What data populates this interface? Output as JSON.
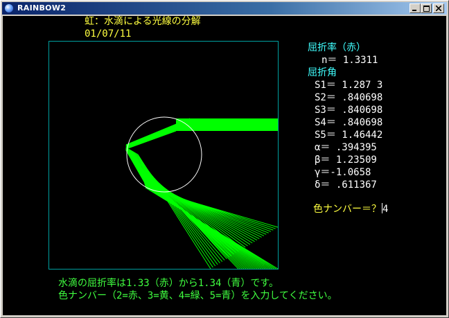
{
  "window": {
    "title": "RAINBOW2",
    "buttons": [
      "minimize",
      "maximize",
      "close"
    ]
  },
  "header": {
    "title": "虹：水滴による光線の分解",
    "date": "01/07/11"
  },
  "panel": {
    "refraction_label": "屈折率（赤）",
    "n_value": "n＝ 1.3311",
    "angle_label": "屈折角",
    "values": [
      "S1＝ 1.287 3",
      "S2＝ .840698",
      "S3＝ .840698",
      "S4＝ .840698",
      "S5＝ 1.46442",
      "α＝ .394395",
      "β＝ 1.23509",
      "γ＝-1.0658",
      "δ＝ .611367"
    ],
    "prompt_label": "色ナンバー＝？",
    "prompt_value": "4"
  },
  "footer": {
    "line1": "水滴の屈折率は1.33（赤）から1.34（青）です。",
    "line2": "色ナンバー（2=赤、3=黄、4=緑、5=青）を入力してください。"
  },
  "colors": {
    "background": "#000000",
    "title_text": "#ffff40",
    "panel_text": "#40ffff",
    "value_text": "#ffffff",
    "footer_text": "#40ff40",
    "ray_color": "#00ff00",
    "frame_color": "#00a0a0",
    "droplet_color": "#ffffff"
  }
}
